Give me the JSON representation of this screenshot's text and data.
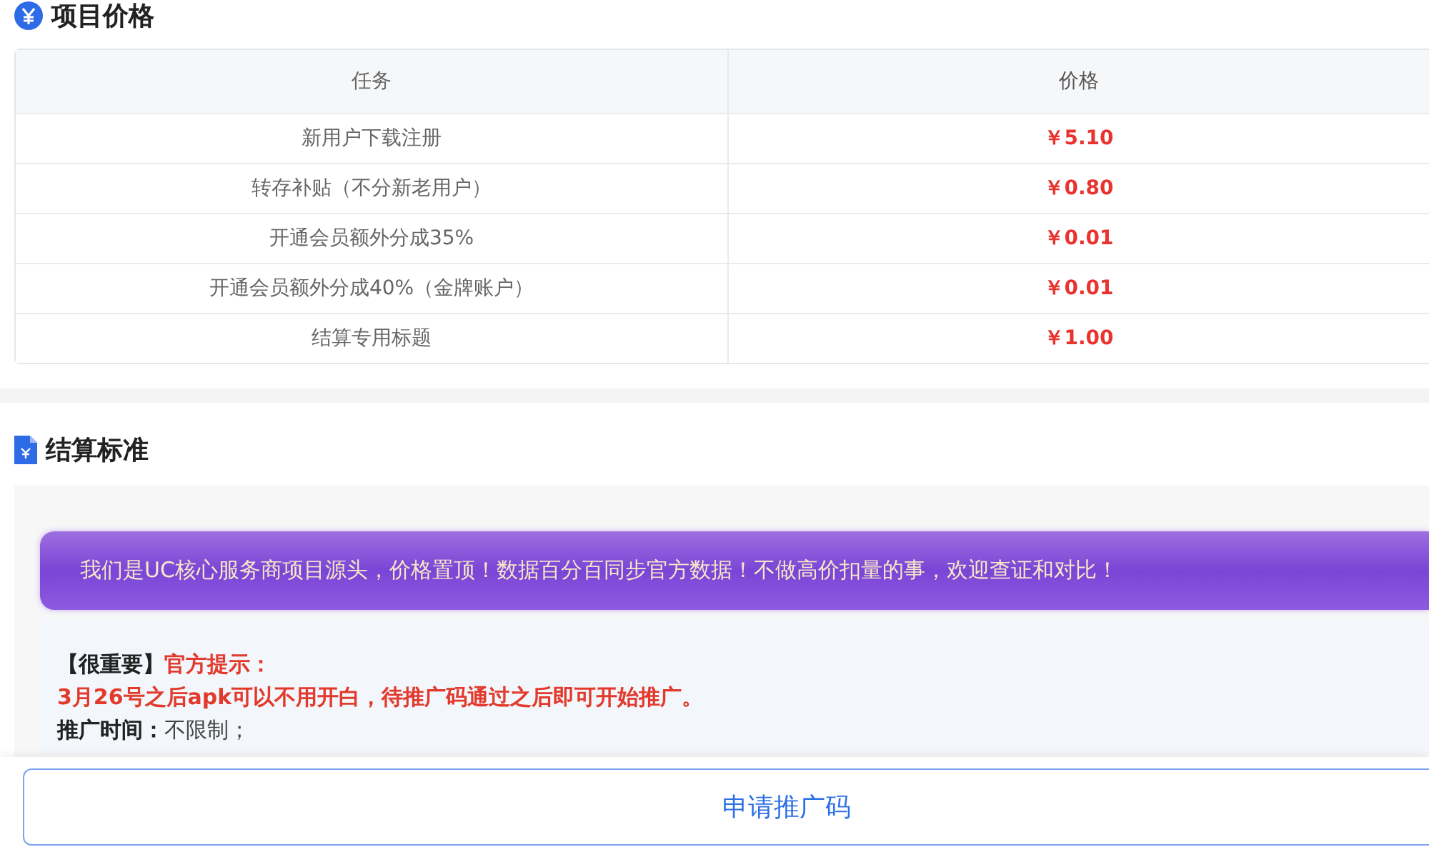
{
  "price_section": {
    "title": "项目价格",
    "table": {
      "columns": [
        "任务",
        "价格"
      ],
      "rows": [
        {
          "task": "新用户下载注册",
          "price": "￥5.10"
        },
        {
          "task": "转存补贴（不分新老用户）",
          "price": "￥0.80"
        },
        {
          "task": "开通会员额外分成35%",
          "price": "￥0.01"
        },
        {
          "task": "开通会员额外分成40%（金牌账户）",
          "price": "￥0.01"
        },
        {
          "task": "结算专用标题",
          "price": "￥1.00"
        }
      ]
    }
  },
  "settlement_section": {
    "title": "结算标准",
    "banner": "我们是UC核心服务商项目源头，价格置顶！数据百分百同步官方数据！不做高价扣量的事，欢迎查证和对比！",
    "notice": {
      "label": "【很重要】",
      "highlight": "官方提示：",
      "alert": "3月26号之后apk可以不用开白，待推广码通过之后即可开始推广。",
      "field_label": "推广时间：",
      "field_value": "不限制；"
    }
  },
  "apply_button": "申请推广码"
}
